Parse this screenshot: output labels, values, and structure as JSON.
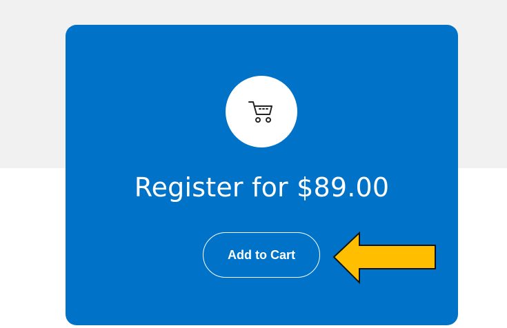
{
  "card": {
    "background_color": "#0073c8",
    "icon": "shopping-cart-icon",
    "title": "Register for $89.00",
    "add_to_cart_label": "Add to Cart"
  },
  "annotation": {
    "icon": "pointer-arrow-icon",
    "color": "#ffbf00"
  }
}
